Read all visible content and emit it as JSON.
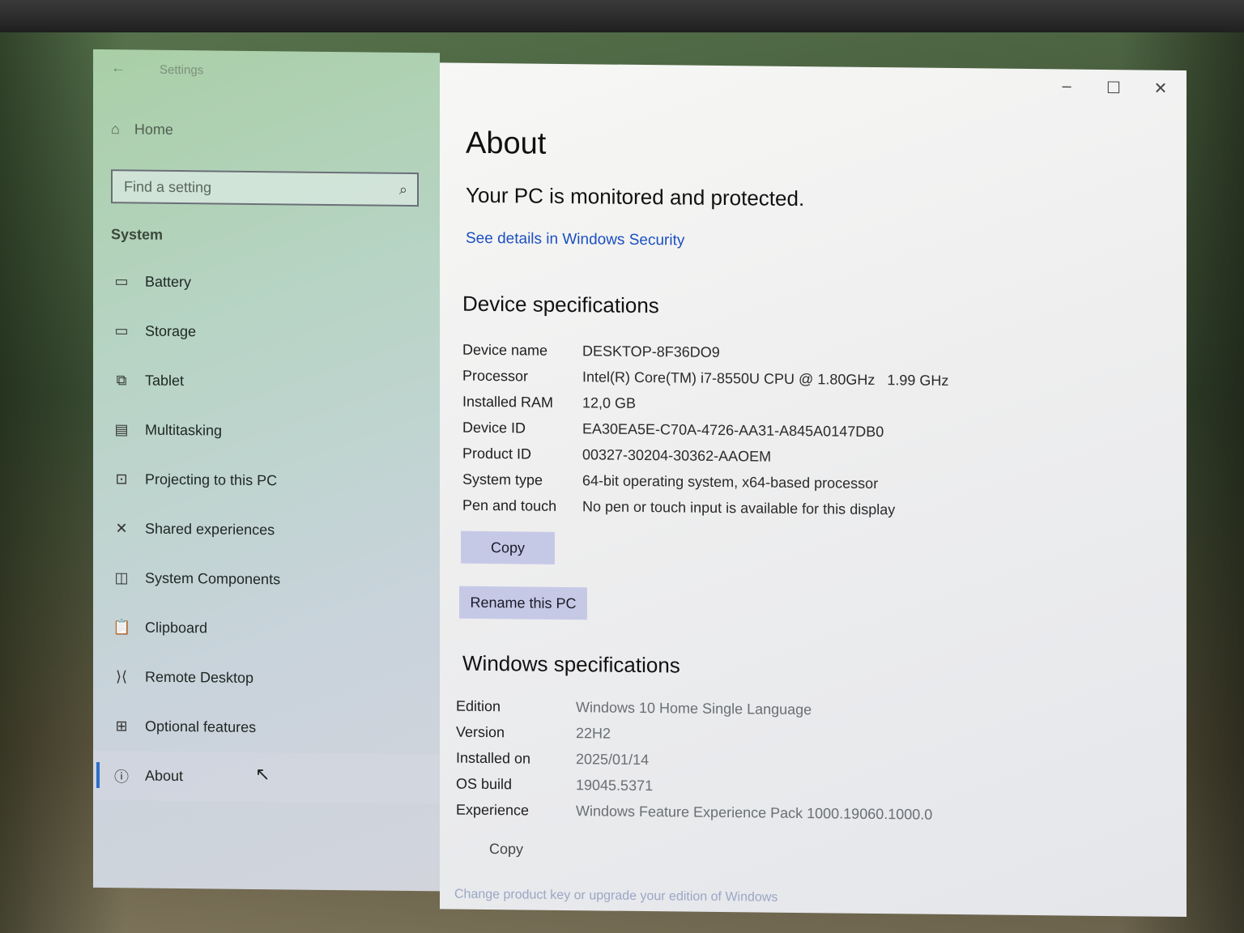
{
  "window": {
    "title": "Settings",
    "controls": {
      "minimize": "–",
      "maximize": "☐",
      "close": "✕"
    }
  },
  "sidebar": {
    "home_label": "Home",
    "search_placeholder": "Find a setting",
    "section": "System",
    "items": [
      {
        "label": "Battery",
        "icon": "▭",
        "icon_name": "battery-icon"
      },
      {
        "label": "Storage",
        "icon": "▭",
        "icon_name": "storage-icon"
      },
      {
        "label": "Tablet",
        "icon": "⧉",
        "icon_name": "tablet-icon"
      },
      {
        "label": "Multitasking",
        "icon": "▤",
        "icon_name": "multitasking-icon"
      },
      {
        "label": "Projecting to this PC",
        "icon": "⊡",
        "icon_name": "projecting-icon"
      },
      {
        "label": "Shared experiences",
        "icon": "✕",
        "icon_name": "shared-experiences-icon"
      },
      {
        "label": "System Components",
        "icon": "◫",
        "icon_name": "system-components-icon"
      },
      {
        "label": "Clipboard",
        "icon": "📋",
        "icon_name": "clipboard-icon"
      },
      {
        "label": "Remote Desktop",
        "icon": "⟩⟨",
        "icon_name": "remote-desktop-icon"
      },
      {
        "label": "Optional features",
        "icon": "⊞",
        "icon_name": "optional-features-icon"
      },
      {
        "label": "About",
        "icon": "ⓘ",
        "icon_name": "info-icon",
        "active": true
      }
    ]
  },
  "content": {
    "title": "About",
    "protection_status": "Your PC is monitored and protected.",
    "security_link": "See details in Windows Security",
    "device_heading": "Device specifications",
    "device_specs": [
      {
        "label": "Device name",
        "value": "DESKTOP-8F36DO9"
      },
      {
        "label": "Processor",
        "value": "Intel(R) Core(TM) i7-8550U CPU @ 1.80GHz   1.99 GHz"
      },
      {
        "label": "Installed RAM",
        "value": "12,0 GB"
      },
      {
        "label": "Device ID",
        "value": "EA30EA5E-C70A-4726-AA31-A845A0147DB0"
      },
      {
        "label": "Product ID",
        "value": "00327-30204-30362-AAOEM"
      },
      {
        "label": "System type",
        "value": "64-bit operating system, x64-based processor"
      },
      {
        "label": "Pen and touch",
        "value": "No pen or touch input is available for this display"
      }
    ],
    "copy_label": "Copy",
    "rename_label": "Rename this PC",
    "windows_heading": "Windows specifications",
    "windows_specs": [
      {
        "label": "Edition",
        "value": "Windows 10 Home Single Language"
      },
      {
        "label": "Version",
        "value": "22H2"
      },
      {
        "label": "Installed on",
        "value": "2025/01/14"
      },
      {
        "label": "OS build",
        "value": "19045.5371"
      },
      {
        "label": "Experience",
        "value": "Windows Feature Experience Pack 1000.19060.1000.0"
      }
    ],
    "copy2_label": "Copy",
    "product_key_link": "Change product key or upgrade your edition of Windows"
  }
}
